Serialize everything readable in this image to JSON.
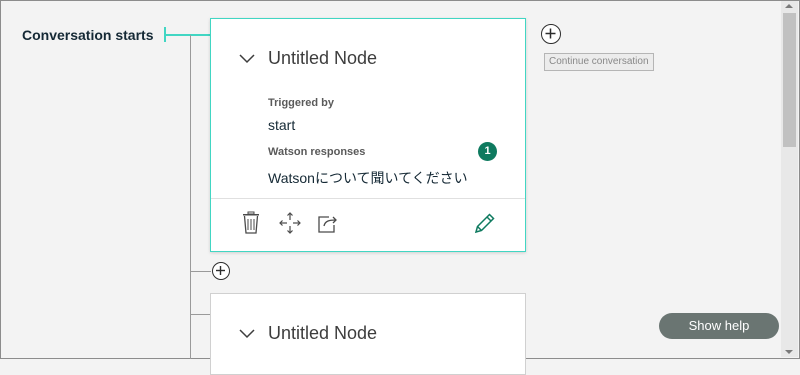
{
  "tree": {
    "start_label": "Conversation starts"
  },
  "node1": {
    "title": "Untitled Node",
    "triggered_label": "Triggered by",
    "triggered_value": "start",
    "responses_label": "Watson responses",
    "responses_count": "1",
    "response_value": "Watsonについて聞いてください"
  },
  "node2": {
    "title": "Untitled Node"
  },
  "tooltip": {
    "continue": "Continue conversation"
  },
  "help": {
    "label": "Show help"
  },
  "colors": {
    "accent": "#41d6c3",
    "badge": "#0e7a5f",
    "edit": "#0e7a5f",
    "help_bg": "#6a7572"
  },
  "icons": {
    "delete": "trash-icon",
    "move": "move-icon",
    "jump": "jump-to-icon",
    "edit": "pencil-icon",
    "add": "plus-circle-icon",
    "collapse": "chevron-down-icon"
  }
}
